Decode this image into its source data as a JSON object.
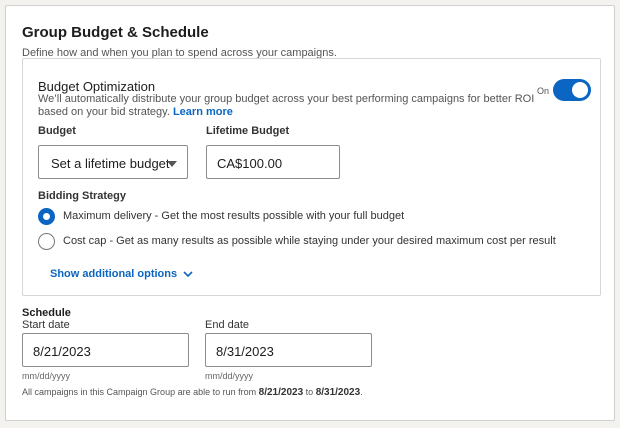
{
  "section": {
    "title": "Group Budget & Schedule",
    "subtitle": "Define how and when you plan to spend across your campaigns."
  },
  "budget_optimization": {
    "title": "Budget Optimization",
    "description": "We’ll automatically distribute your group budget across your best performing campaigns for better ROI based on your bid strategy.",
    "learn_more": "Learn more",
    "toggle_label": "On",
    "toggle_on": true
  },
  "budget": {
    "label": "Budget",
    "selected": "Set a lifetime budget",
    "lifetime_label": "Lifetime Budget",
    "lifetime_value": "CA$100.00"
  },
  "bidding": {
    "label": "Bidding Strategy",
    "options": [
      {
        "text": "Maximum delivery - Get the most results possible with your full budget",
        "checked": true
      },
      {
        "text": "Cost cap - Get as many results as possible while staying under your desired maximum cost per result",
        "checked": false
      }
    ],
    "show_more": "Show additional options"
  },
  "schedule": {
    "title": "Schedule",
    "start_label": "Start date",
    "start_value": "8/21/2023",
    "end_label": "End date",
    "end_value": "8/31/2023",
    "format_hint": "mm/dd/yyyy",
    "note_prefix": "All campaigns in this Campaign Group are able to run from",
    "note_start": "8/21/2023",
    "note_mid": "to",
    "note_end": "8/31/2023",
    "note_suffix": "."
  },
  "colors": {
    "accent": "#0a66c2",
    "background": "#f3f2ef",
    "card": "#ffffff"
  }
}
